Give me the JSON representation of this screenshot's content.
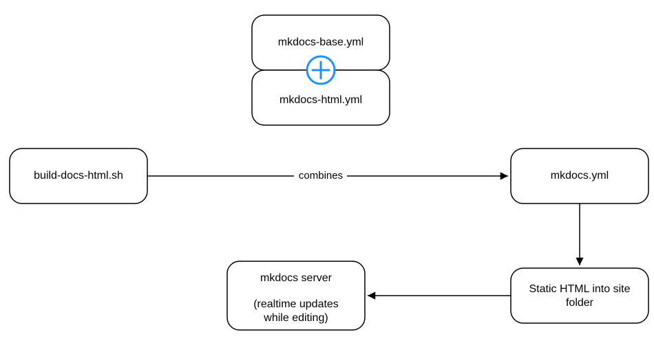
{
  "diagram": {
    "nodes": {
      "build_script": {
        "label": "build-docs-html.sh"
      },
      "base_yml": {
        "label": "mkdocs-base.yml"
      },
      "html_yml": {
        "label": "mkdocs-html.yml"
      },
      "mkdocs_yml": {
        "label": "mkdocs.yml"
      },
      "static_html": {
        "line1": "Static HTML into site",
        "line2": "folder"
      },
      "server": {
        "line1": "mkdocs server",
        "line2": "(realtime updates",
        "line3": "while editing)"
      }
    },
    "edges": {
      "combines": {
        "label": "combines"
      }
    },
    "icon": {
      "plus": "plus-circle-icon"
    },
    "colors": {
      "accent": "#1e90ff",
      "stroke": "#000000",
      "bg": "#ffffff"
    }
  }
}
